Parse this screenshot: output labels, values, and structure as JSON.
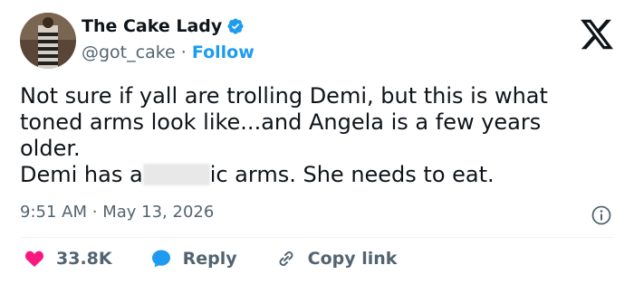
{
  "author": {
    "name": "The Cake Lady",
    "handle": "@got_cake",
    "separator": "·",
    "follow_label": "Follow"
  },
  "tweet": {
    "line1": "Not sure if yall are trolling Demi, but this is what toned arms look like...and Angela is a few years older.",
    "line2_before": "Demi has a",
    "line2_after": "ic arms. She needs to eat."
  },
  "meta": {
    "time": "9:51 AM",
    "separator": "·",
    "date": "May 13, 2026"
  },
  "actions": {
    "likes": "33.8K",
    "reply_label": "Reply",
    "copy_label": "Copy link"
  },
  "colors": {
    "accent": "#1d9bf0",
    "like": "#f91880",
    "text": "#0f1419",
    "muted": "#536471"
  },
  "icons": {
    "verified": "verified-badge-icon",
    "brand": "x-logo-icon",
    "info": "info-icon",
    "like": "heart-icon",
    "reply": "speech-bubble-icon",
    "copy": "link-icon"
  }
}
